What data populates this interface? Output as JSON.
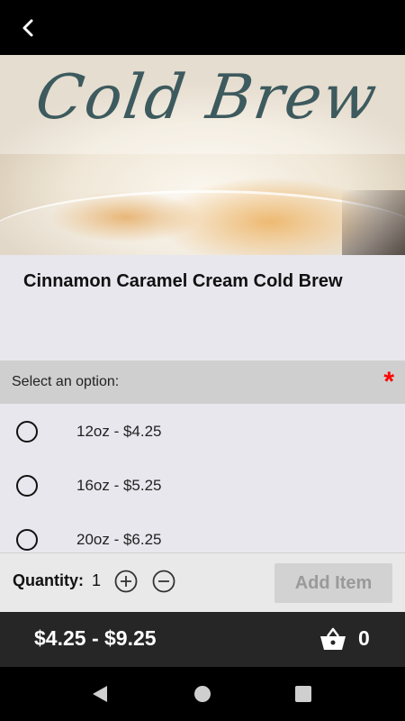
{
  "header": {
    "back_icon": "chevron-left-icon"
  },
  "hero": {
    "title": "Cold Brew"
  },
  "product": {
    "name": "Cinnamon Caramel Cream Cold Brew"
  },
  "options": {
    "header_label": "Select an option:",
    "required_marker": "*",
    "items": [
      {
        "label": "12oz - $4.25",
        "selected": false
      },
      {
        "label": "16oz - $5.25",
        "selected": false
      },
      {
        "label": "20oz - $6.25",
        "selected": false
      }
    ]
  },
  "quantity": {
    "label": "Quantity:",
    "value": "1",
    "increment_icon": "plus-circle-icon",
    "decrement_icon": "minus-circle-icon"
  },
  "add_button": {
    "label": "Add Item",
    "enabled": false
  },
  "footer": {
    "price_range": "$4.25 - $9.25",
    "cart_icon": "basket-icon",
    "cart_count": "0"
  },
  "system_nav": {
    "back": "triangle-back-icon",
    "home": "circle-home-icon",
    "recents": "square-recents-icon"
  },
  "colors": {
    "required": "#ff0000",
    "footer_bg": "#262626",
    "title_ink": "#3d5a5e"
  }
}
